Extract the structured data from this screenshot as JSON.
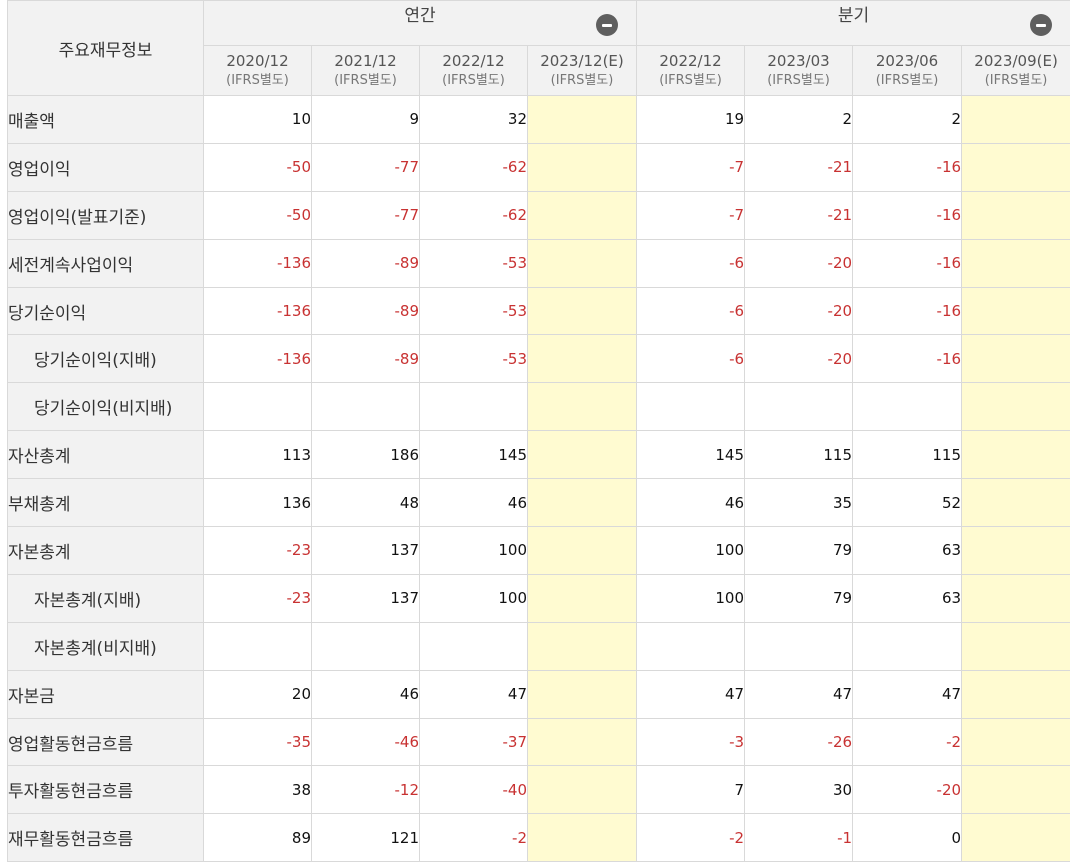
{
  "table": {
    "title": "주요재무정보",
    "groups": [
      {
        "label": "연간",
        "toggle_icon": "minus-circle-icon"
      },
      {
        "label": "분기",
        "toggle_icon": "minus-circle-icon"
      }
    ],
    "columns": [
      {
        "period": "2020/12",
        "basis": "(IFRS별도)"
      },
      {
        "period": "2021/12",
        "basis": "(IFRS별도)"
      },
      {
        "period": "2022/12",
        "basis": "(IFRS별도)"
      },
      {
        "period": "2023/12(E)",
        "basis": "(IFRS별도)"
      },
      {
        "period": "2022/12",
        "basis": "(IFRS별도)"
      },
      {
        "period": "2023/03",
        "basis": "(IFRS별도)"
      },
      {
        "period": "2023/06",
        "basis": "(IFRS별도)"
      },
      {
        "period": "2023/09(E)",
        "basis": "(IFRS별도)"
      }
    ],
    "rows": [
      {
        "label": "매출액",
        "indent": false,
        "values": [
          "10",
          "9",
          "32",
          "",
          "19",
          "2",
          "2",
          ""
        ]
      },
      {
        "label": "영업이익",
        "indent": false,
        "values": [
          "-50",
          "-77",
          "-62",
          "",
          "-7",
          "-21",
          "-16",
          ""
        ]
      },
      {
        "label": "영업이익(발표기준)",
        "indent": false,
        "values": [
          "-50",
          "-77",
          "-62",
          "",
          "-7",
          "-21",
          "-16",
          ""
        ]
      },
      {
        "label": "세전계속사업이익",
        "indent": false,
        "values": [
          "-136",
          "-89",
          "-53",
          "",
          "-6",
          "-20",
          "-16",
          ""
        ]
      },
      {
        "label": "당기순이익",
        "indent": false,
        "values": [
          "-136",
          "-89",
          "-53",
          "",
          "-6",
          "-20",
          "-16",
          ""
        ]
      },
      {
        "label": "당기순이익(지배)",
        "indent": true,
        "values": [
          "-136",
          "-89",
          "-53",
          "",
          "-6",
          "-20",
          "-16",
          ""
        ]
      },
      {
        "label": "당기순이익(비지배)",
        "indent": true,
        "values": [
          "",
          "",
          "",
          "",
          "",
          "",
          "",
          ""
        ]
      },
      {
        "label": "자산총계",
        "indent": false,
        "values": [
          "113",
          "186",
          "145",
          "",
          "145",
          "115",
          "115",
          ""
        ]
      },
      {
        "label": "부채총계",
        "indent": false,
        "values": [
          "136",
          "48",
          "46",
          "",
          "46",
          "35",
          "52",
          ""
        ]
      },
      {
        "label": "자본총계",
        "indent": false,
        "values": [
          "-23",
          "137",
          "100",
          "",
          "100",
          "79",
          "63",
          ""
        ]
      },
      {
        "label": "자본총계(지배)",
        "indent": true,
        "values": [
          "-23",
          "137",
          "100",
          "",
          "100",
          "79",
          "63",
          ""
        ]
      },
      {
        "label": "자본총계(비지배)",
        "indent": true,
        "values": [
          "",
          "",
          "",
          "",
          "",
          "",
          "",
          ""
        ]
      },
      {
        "label": "자본금",
        "indent": false,
        "values": [
          "20",
          "46",
          "47",
          "",
          "47",
          "47",
          "47",
          ""
        ]
      },
      {
        "label": "영업활동현금흐름",
        "indent": false,
        "values": [
          "-35",
          "-46",
          "-37",
          "",
          "-3",
          "-26",
          "-2",
          ""
        ]
      },
      {
        "label": "투자활동현금흐름",
        "indent": false,
        "values": [
          "38",
          "-12",
          "-40",
          "",
          "7",
          "30",
          "-20",
          ""
        ]
      },
      {
        "label": "재무활동현금흐름",
        "indent": false,
        "values": [
          "89",
          "121",
          "-2",
          "",
          "-2",
          "-1",
          "0",
          ""
        ]
      }
    ]
  },
  "colors": {
    "negative": "#c83232",
    "estimate_bg": "#fffbd1",
    "header_bg": "#f2f2f2",
    "border": "#d9d9d9"
  }
}
